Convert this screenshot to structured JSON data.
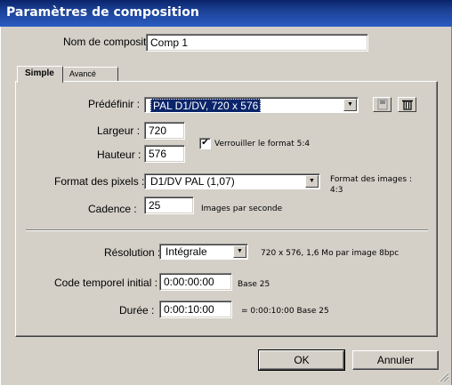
{
  "window": {
    "title": "Paramètres de composition"
  },
  "comp_name": {
    "label": "Nom de composition :",
    "value": "Comp 1"
  },
  "tabs": [
    {
      "label": "Simple"
    },
    {
      "label": "Avancé"
    }
  ],
  "preset": {
    "label": "Prédéfinir :",
    "value": "PAL D1/DV, 720 x 576",
    "save_icon": "save-icon",
    "delete_icon": "trash-icon"
  },
  "width": {
    "label": "Largeur :",
    "value": "720"
  },
  "height": {
    "label": "Hauteur :",
    "value": "576"
  },
  "lock_ratio": {
    "label": "Verrouiller le format 5:4",
    "checked": true,
    "mark": "✔"
  },
  "pixel_format": {
    "label": "Format des pixels :",
    "value": "D1/DV PAL (1,07)",
    "frame_aspect_label": "Format des images :",
    "frame_aspect_value": "4:3"
  },
  "frame_rate": {
    "label": "Cadence :",
    "value": "25",
    "unit": "Images par seconde"
  },
  "resolution": {
    "label": "Résolution :",
    "value": "Intégrale",
    "info": "720 x 576, 1,6 Mo par image 8bpc"
  },
  "start_timecode": {
    "label": "Code temporel initial :",
    "value": "0:00:00:00",
    "base": "Base 25"
  },
  "duration": {
    "label": "Durée :",
    "value": "0:00:10:00",
    "equals": "= 0:00:10:00  Base 25"
  },
  "buttons": {
    "ok": "OK",
    "cancel": "Annuler"
  },
  "colors": {
    "titlebar": "#0a246a",
    "face": "#d4d0c8",
    "selection": "#0a246a"
  }
}
